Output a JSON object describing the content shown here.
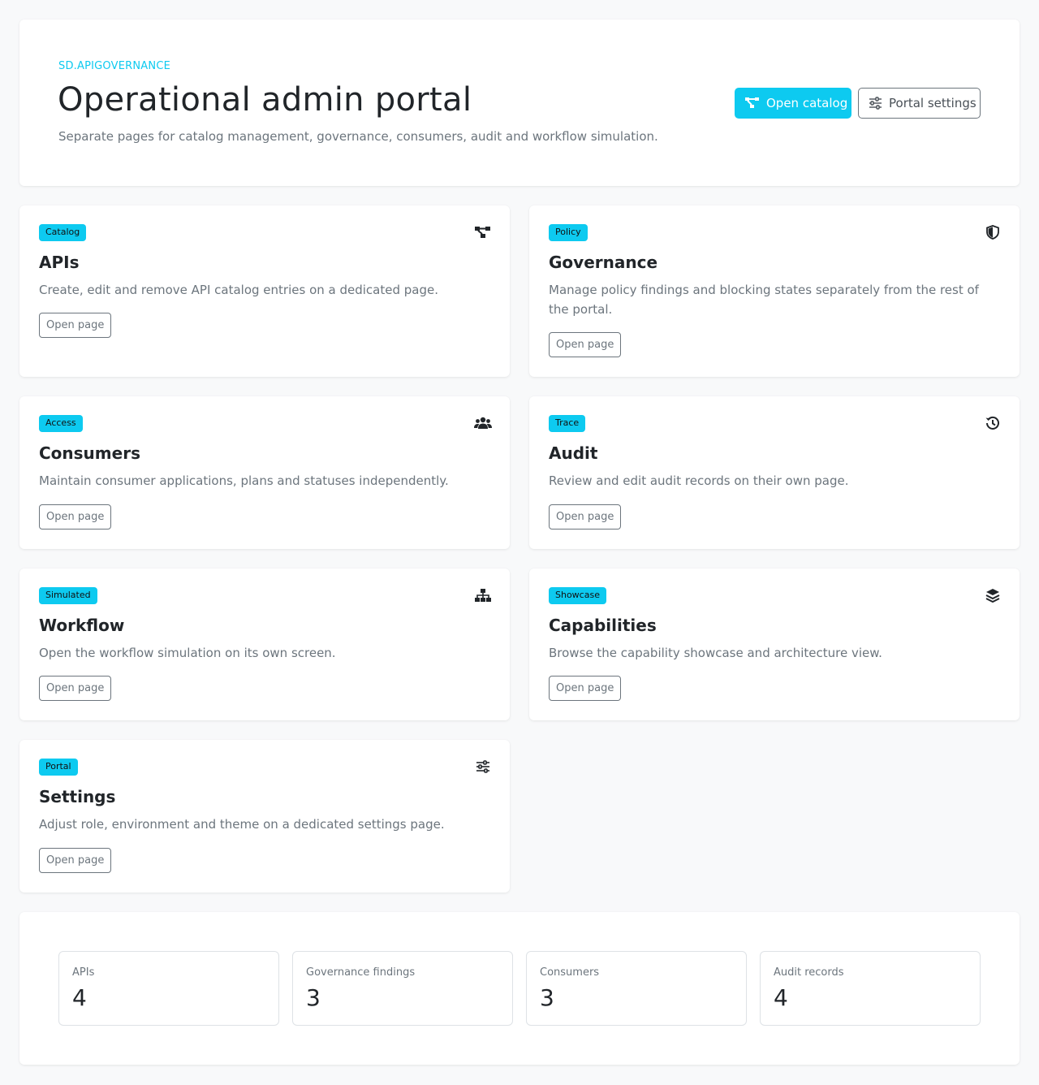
{
  "hero": {
    "eyebrow": "SD.APIGOVERNANCE",
    "title": "Operational admin portal",
    "subtitle": "Separate pages for catalog management, governance, consumers, audit and workflow simulation.",
    "primary_button": "Open catalog",
    "primary_icon": "diagram-icon",
    "secondary_button": "Portal settings",
    "secondary_icon": "sliders-icon"
  },
  "cards": [
    {
      "badge": "Catalog",
      "title": "APIs",
      "description": "Create, edit and remove API catalog entries on a dedicated page.",
      "button": "Open page",
      "icon": "diagram-icon"
    },
    {
      "badge": "Policy",
      "title": "Governance",
      "description": "Manage policy findings and blocking states separately from the rest of the portal.",
      "button": "Open page",
      "icon": "shield-icon"
    },
    {
      "badge": "Access",
      "title": "Consumers",
      "description": "Maintain consumer applications, plans and statuses independently.",
      "button": "Open page",
      "icon": "people-icon"
    },
    {
      "badge": "Trace",
      "title": "Audit",
      "description": "Review and edit audit records on their own page.",
      "button": "Open page",
      "icon": "history-icon"
    },
    {
      "badge": "Simulated",
      "title": "Workflow",
      "description": "Open the workflow simulation on its own screen.",
      "button": "Open page",
      "icon": "hierarchy-icon"
    },
    {
      "badge": "Showcase",
      "title": "Capabilities",
      "description": "Browse the capability showcase and architecture view.",
      "button": "Open page",
      "icon": "layers-icon"
    },
    {
      "badge": "Portal",
      "title": "Settings",
      "description": "Adjust role, environment and theme on a dedicated settings page.",
      "button": "Open page",
      "icon": "sliders-icon"
    }
  ],
  "stats": [
    {
      "label": "APIs",
      "value": "4"
    },
    {
      "label": "Governance findings",
      "value": "3"
    },
    {
      "label": "Consumers",
      "value": "3"
    },
    {
      "label": "Audit records",
      "value": "4"
    }
  ],
  "colors": {
    "accent": "#0dcaf0",
    "muted_text": "#6c757d",
    "text": "#212529",
    "background": "#f8f9fa"
  }
}
